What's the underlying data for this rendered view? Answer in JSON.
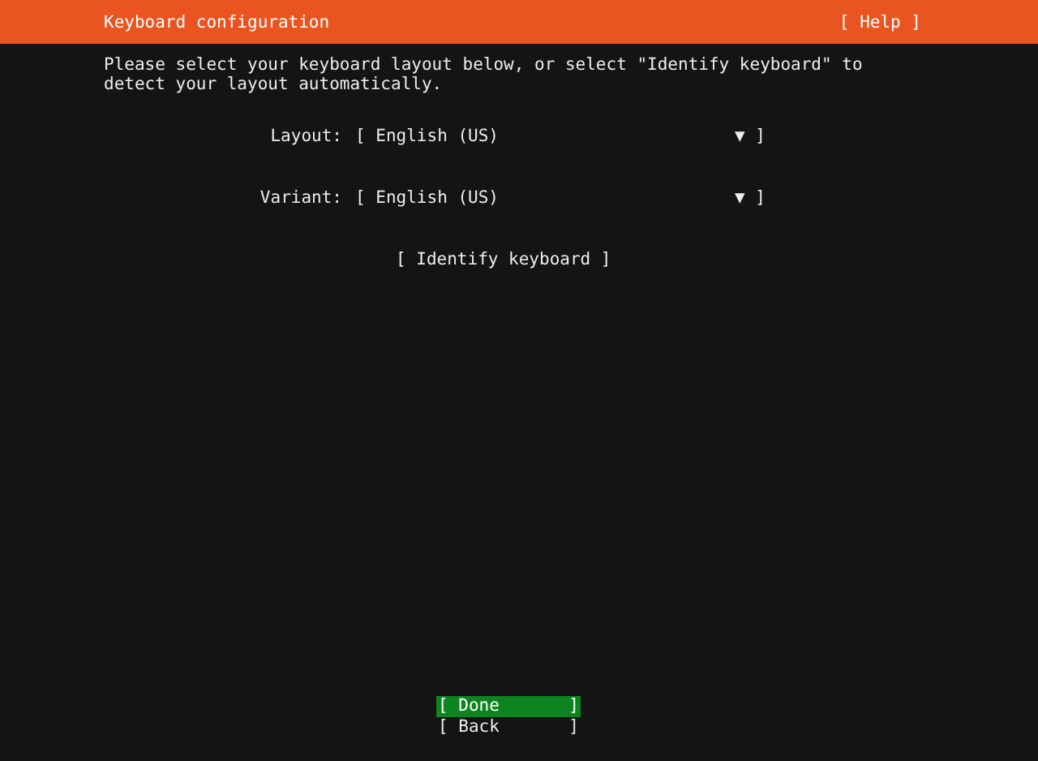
{
  "header": {
    "title": "Keyboard configuration",
    "help_button": "[ Help ]"
  },
  "instructions": "Please select your keyboard layout below, or select \"Identify keyboard\" to detect your layout automatically.",
  "fields": [
    {
      "label": "Layout:",
      "open": "[",
      "value": "English (US)",
      "arrow": "▼",
      "close": "]"
    },
    {
      "label": "Variant:",
      "open": "[",
      "value": "English (US)",
      "arrow": "▼",
      "close": "]"
    }
  ],
  "identify_button": "[ Identify keyboard ]",
  "buttons": [
    {
      "open": "[",
      "label": "Done",
      "close": "]",
      "selected": true
    },
    {
      "open": "[",
      "label": "Back",
      "close": "]",
      "selected": false
    }
  ]
}
